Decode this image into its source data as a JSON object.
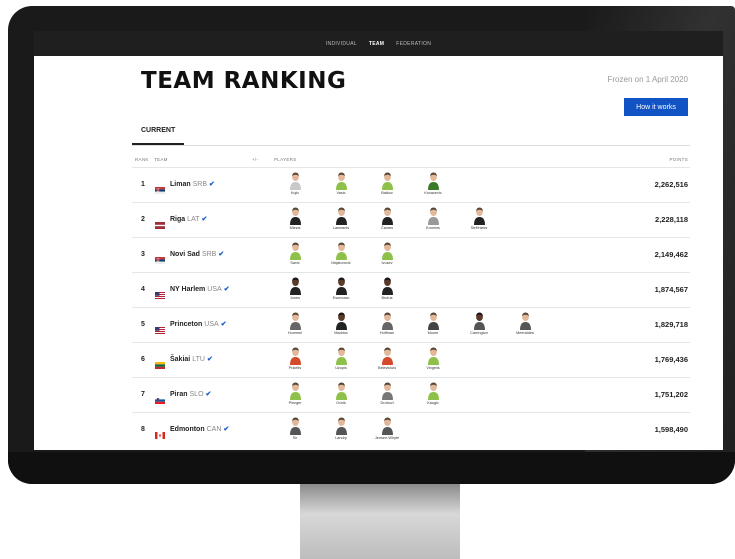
{
  "nav": {
    "tabs": [
      "INDIVIDUAL",
      "TEAM",
      "FEDERATION"
    ],
    "active": "TEAM"
  },
  "page": {
    "title": "TEAM RANKING",
    "frozen": "Frozen on 1 April 2020",
    "how_it_works": "How it works",
    "tab_current": "CURRENT"
  },
  "headers": {
    "rank": "RANK",
    "team": "TEAM",
    "change": "+/-",
    "players": "PLAYERS",
    "points": "POINTS"
  },
  "colors": {
    "accent": "#1153c4",
    "nav_bg": "#1f1f1f",
    "verified": "#1a5ccc"
  },
  "rows": [
    {
      "rank": "1",
      "team": "Liman",
      "country": "SRB",
      "flag": "serbia",
      "points": "2,262,516",
      "players": [
        {
          "name": "Kojic",
          "tone": "light",
          "jersey": "#c9c9c9"
        },
        {
          "name": "Vasic",
          "tone": "light",
          "jersey": "#8fc14a"
        },
        {
          "name": "Batkov",
          "tone": "light",
          "jersey": "#8fc14a"
        },
        {
          "name": "Kovacevic",
          "tone": "light",
          "jersey": "#3a7a2a"
        }
      ]
    },
    {
      "rank": "2",
      "team": "Riga",
      "country": "LAT",
      "flag": "latvia",
      "points": "2,228,118",
      "players": [
        {
          "name": "Miezis",
          "tone": "light",
          "jersey": "#222222"
        },
        {
          "name": "Lasmanis",
          "tone": "light",
          "jersey": "#222222"
        },
        {
          "name": "Čavars",
          "tone": "light",
          "jersey": "#222222"
        },
        {
          "name": "Kromins",
          "tone": "light",
          "jersey": "#999999"
        },
        {
          "name": "Strēlnieks",
          "tone": "light",
          "jersey": "#222222"
        }
      ]
    },
    {
      "rank": "3",
      "team": "Novi Sad",
      "country": "SRB",
      "flag": "serbia",
      "points": "2,149,462",
      "players": [
        {
          "name": "Savić",
          "tone": "light",
          "jersey": "#8fc14a"
        },
        {
          "name": "Majstorović",
          "tone": "light",
          "jersey": "#8fc14a"
        },
        {
          "name": "Ivosev",
          "tone": "light",
          "jersey": "#8fc14a"
        }
      ]
    },
    {
      "rank": "4",
      "team": "NY Harlem",
      "country": "USA",
      "flag": "usa",
      "points": "1,874,567",
      "players": [
        {
          "name": "Jones",
          "tone": "dark",
          "jersey": "#222222"
        },
        {
          "name": "Esomowo",
          "tone": "dark",
          "jersey": "#222222"
        },
        {
          "name": "Brutus",
          "tone": "dark",
          "jersey": "#222222"
        }
      ]
    },
    {
      "rank": "5",
      "team": "Princeton",
      "country": "USA",
      "flag": "usa",
      "points": "1,829,718",
      "players": [
        {
          "name": "Hummel",
          "tone": "light",
          "jersey": "#666666"
        },
        {
          "name": "Maddox",
          "tone": "dark",
          "jersey": "#222222"
        },
        {
          "name": "Huffman",
          "tone": "light",
          "jersey": "#666666"
        },
        {
          "name": "Moore",
          "tone": "light",
          "jersey": "#444444"
        },
        {
          "name": "Carrington",
          "tone": "dark",
          "jersey": "#555555"
        },
        {
          "name": "Meeraides",
          "tone": "light",
          "jersey": "#555555"
        }
      ]
    },
    {
      "rank": "6",
      "team": "Šakiai",
      "country": "LTU",
      "flag": "lithuania",
      "points": "1,769,436",
      "players": [
        {
          "name": "Pukelis",
          "tone": "light",
          "jersey": "#d44a2a"
        },
        {
          "name": "Uzupis",
          "tone": "light",
          "jersey": "#8fc14a"
        },
        {
          "name": "Beleviciuis",
          "tone": "light",
          "jersey": "#d44a2a"
        },
        {
          "name": "Vingelis",
          "tone": "light",
          "jersey": "#8fc14a"
        }
      ]
    },
    {
      "rank": "7",
      "team": "Piran",
      "country": "SLO",
      "flag": "slovenia",
      "points": "1,751,202",
      "players": [
        {
          "name": "Pinzger",
          "tone": "light",
          "jersey": "#8fc14a"
        },
        {
          "name": "Ovnik",
          "tone": "light",
          "jersey": "#8fc14a"
        },
        {
          "name": "Drobovl",
          "tone": "light",
          "jersey": "#777777"
        },
        {
          "name": "Kaugic",
          "tone": "light",
          "jersey": "#8fc14a"
        }
      ]
    },
    {
      "rank": "8",
      "team": "Edmonton",
      "country": "CAN",
      "flag": "canada",
      "points": "1,598,490",
      "players": [
        {
          "name": "Sir",
          "tone": "light",
          "jersey": "#555555"
        },
        {
          "name": "Landry",
          "tone": "light",
          "jersey": "#555555"
        },
        {
          "name": "Jensen-Whyte",
          "tone": "light",
          "jersey": "#555555"
        }
      ]
    }
  ]
}
